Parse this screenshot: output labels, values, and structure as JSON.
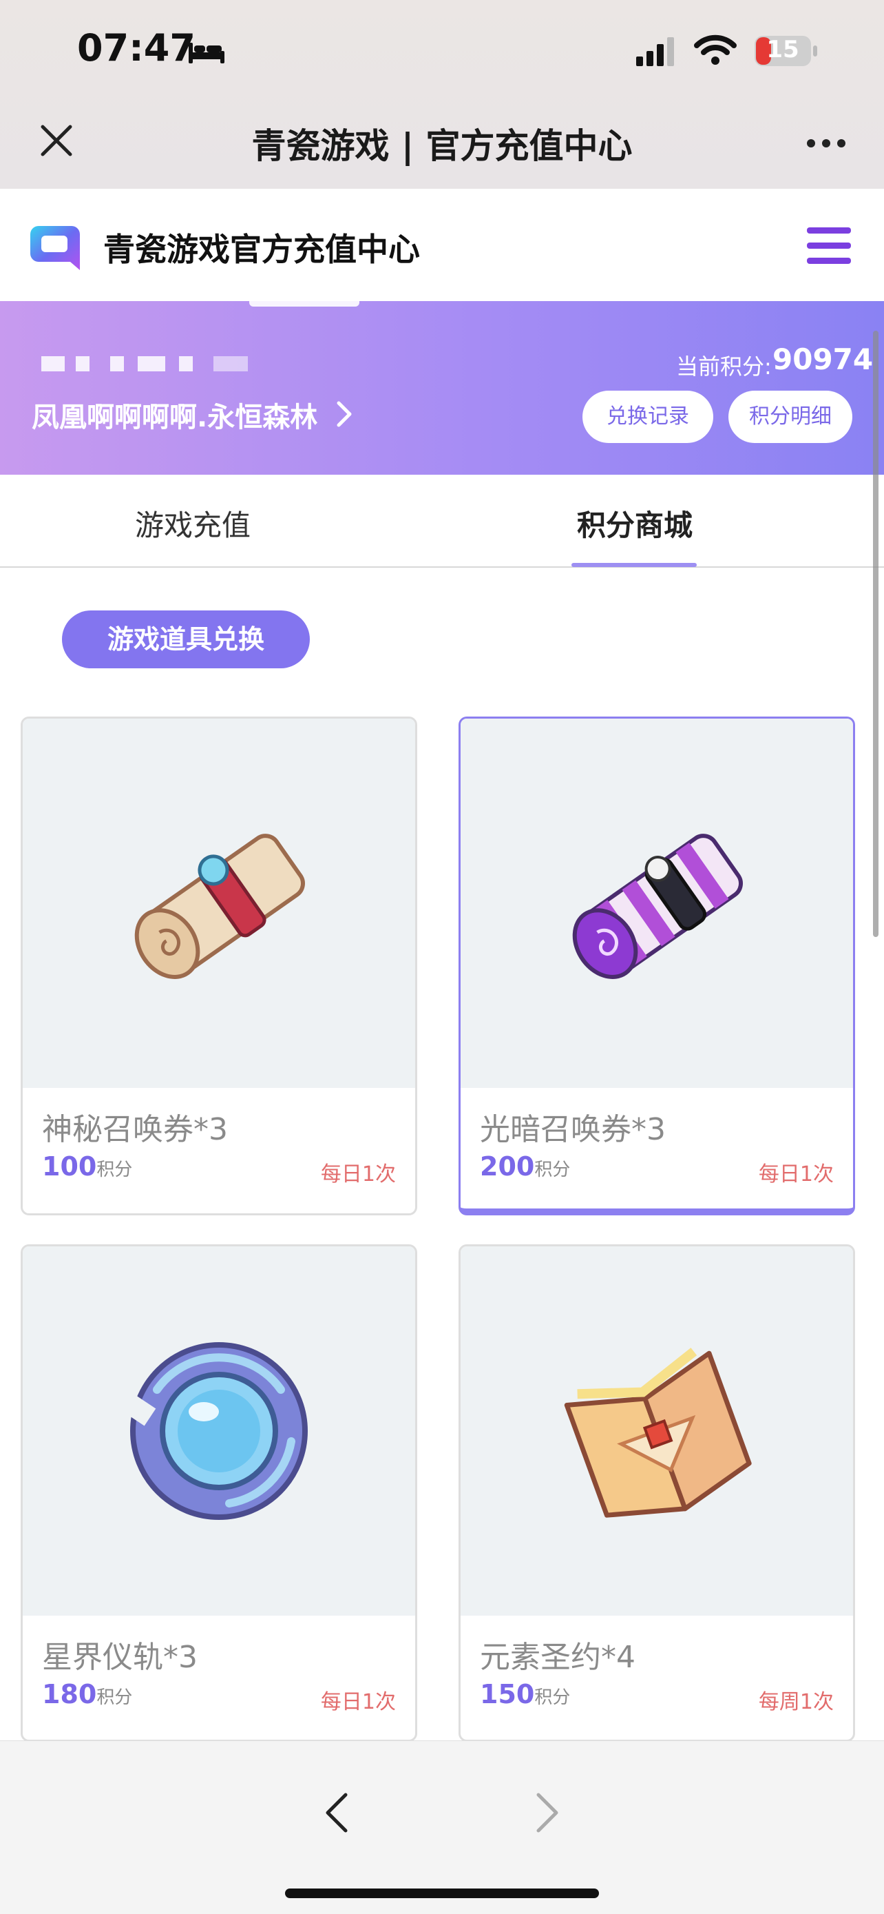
{
  "status_bar": {
    "time": "07:47",
    "battery": "15"
  },
  "browser": {
    "title": "青瓷游戏 | 官方充值中心"
  },
  "site": {
    "title": "青瓷游戏官方充值中心"
  },
  "user": {
    "name": "凤凰啊啊啊啊.永恒森林",
    "points_label": "当前积分:",
    "points_value": "90974",
    "redeem_log_label": "兑换记录",
    "points_detail_label": "积分明细"
  },
  "tabs": [
    {
      "label": "游戏充值",
      "active": false
    },
    {
      "label": "积分商城",
      "active": true
    }
  ],
  "category": {
    "label": "游戏道具兑换"
  },
  "items": [
    {
      "name": "神秘召唤券*3",
      "points": "100",
      "unit": "积分",
      "limit": "每日1次",
      "selected": false
    },
    {
      "name": "光暗召唤券*3",
      "points": "200",
      "unit": "积分",
      "limit": "每日1次",
      "selected": true
    },
    {
      "name": "星界仪轨*3",
      "points": "180",
      "unit": "积分",
      "limit": "每日1次",
      "selected": false
    },
    {
      "name": "元素圣约*4",
      "points": "150",
      "unit": "积分",
      "limit": "每周1次",
      "selected": false
    }
  ],
  "colors": {
    "accent": "#8375ef",
    "limit_text": "#e26c6c",
    "banner_start": "#c79aef",
    "banner_end": "#8a82f3"
  }
}
